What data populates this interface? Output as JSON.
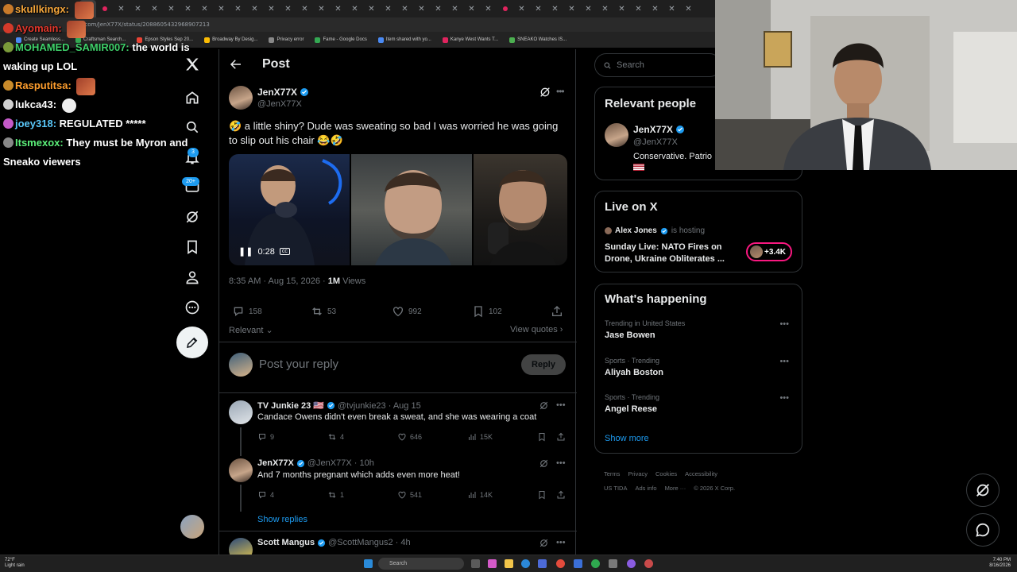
{
  "browser": {
    "url": "x.com/JenX77X/status/2088605432968907213",
    "bookmarks": [
      "Create Seamless...",
      "Craftsman Search...",
      "Epson Styles Sep 20...",
      "Broadway By Desig...",
      "Privacy error",
      "Fame - Google Docs",
      "Item shared with yo...",
      "Kanye West Wants T...",
      "SNEAKO Watches IS..."
    ]
  },
  "chat": [
    {
      "user": "skullkingx:",
      "text": "",
      "color": "#f4a53a"
    },
    {
      "user": "Ayomain:",
      "text": "",
      "color": "#e3372b"
    },
    {
      "user": "MOHAMED_SAMIR007:",
      "text": "the world is",
      "color": "#3fd06a"
    },
    {
      "user": "",
      "text": "waking up LOL",
      "color": "#ffffff"
    },
    {
      "user": "Rasputitsa:",
      "text": "",
      "color": "#ff9e2d"
    },
    {
      "user": "lukca43:",
      "text": "",
      "color": "#ffffff"
    },
    {
      "user": "joey318:",
      "text": "REGULATED *****",
      "color": "#5ac8fa"
    },
    {
      "user": "Itsmexox:",
      "text": "They must be Myron and",
      "color": "#5cf07a"
    },
    {
      "user": "",
      "text": "Sneako viewers",
      "color": "#ffffff"
    }
  ],
  "nav": {
    "notif_count": "3",
    "messages_count": "20+"
  },
  "post": {
    "header_title": "Post",
    "author_name": "JenX77X",
    "author_handle": "@JenX77X",
    "text": "🤣 a little shiny? Dude was sweating so bad I was worried he was going to slip out his chair 😂🤣",
    "video_time": "0:28",
    "timestamp": "8:35 AM · Aug 15, 2026 · ",
    "views_count": "1M",
    "views_label": " Views",
    "replies": "158",
    "reposts": "53",
    "likes": "992",
    "bookmarks": "102",
    "sort_label": "Relevant",
    "view_quotes": "View quotes",
    "reply_placeholder": "Post your reply",
    "reply_button": "Reply"
  },
  "replies": [
    {
      "name": "TV Junkie 23",
      "flag": "🇺🇸",
      "handle": "@tvjunkie23 · Aug 15",
      "text": "Candace Owens didn't even break a sweat, and she was wearing a coat",
      "replies": "9",
      "reposts": "4",
      "likes": "646",
      "views": "15K"
    },
    {
      "name": "JenX77X",
      "flag": "",
      "handle": "@JenX77X · 10h",
      "text": "And 7 months pregnant which adds even more heat!",
      "replies": "4",
      "reposts": "1",
      "likes": "541",
      "views": "14K"
    },
    {
      "name": "Scott Mangus",
      "flag": "",
      "handle": "@ScottMangus2 · 4h",
      "text": ""
    }
  ],
  "show_replies": "Show replies",
  "sidebar": {
    "search_placeholder": "Search",
    "relevant_title": "Relevant people",
    "rp_name": "JenX77X",
    "rp_handle": "@JenX77X",
    "rp_bio": "Conservative. Patrio",
    "live_title": "Live on X",
    "live_host": "Alex Jones",
    "live_hosting": "is hosting",
    "live_text": "Sunday Live: NATO Fires on Drone, Ukraine Obliterates ...",
    "live_count": "+3.4K",
    "happening_title": "What's happening",
    "trends": [
      {
        "context": "Trending in United States",
        "name": "Jase Bowen"
      },
      {
        "context": "Sports · Trending",
        "name": "Aliyah Boston"
      },
      {
        "context": "Sports · Trending",
        "name": "Angel Reese"
      }
    ],
    "show_more": "Show more",
    "footer": [
      "Terms",
      "Privacy",
      "Cookies",
      "Accessibility",
      "US TIDA",
      "Ads info",
      "More ···",
      "© 2026 X Corp."
    ]
  },
  "taskbar": {
    "weather_temp": "72°F",
    "weather_desc": "Light rain",
    "search": "Search",
    "time": "7:40 PM",
    "date": "8/16/2026"
  },
  "colors": {
    "accent": "#1d9bf0",
    "live_ring": "#f91880",
    "background": "#000000"
  }
}
